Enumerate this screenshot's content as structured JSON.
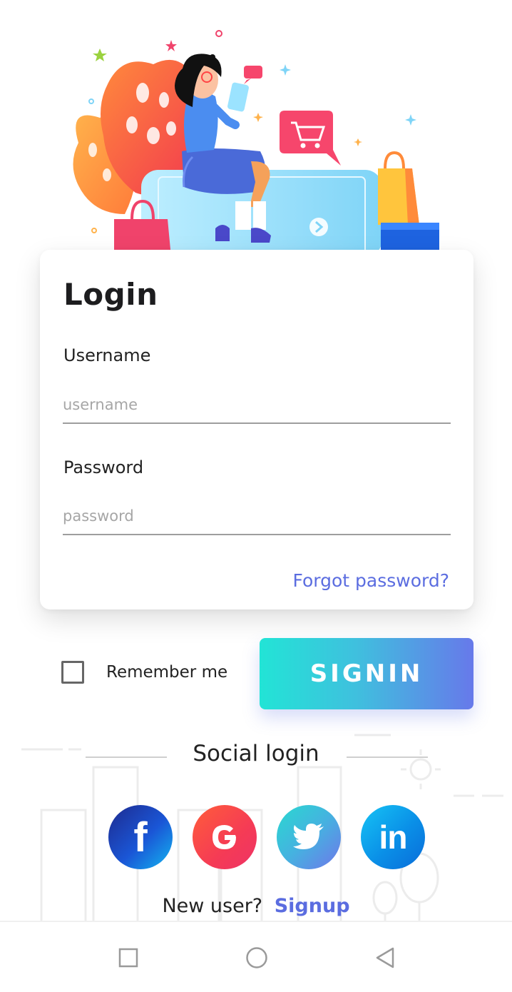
{
  "login": {
    "title": "Login",
    "username_label": "Username",
    "username_placeholder": "username",
    "username_value": "",
    "password_label": "Password",
    "password_placeholder": "password",
    "password_value": "",
    "forgot_label": "Forgot password?"
  },
  "remember": {
    "label": "Remember me",
    "checked": false
  },
  "signin_label": "SIGNIN",
  "social": {
    "title": "Social login",
    "buttons": [
      {
        "icon": "facebook-icon",
        "glyph": "f"
      },
      {
        "icon": "google-icon",
        "glyph": "G"
      },
      {
        "icon": "twitter-icon",
        "glyph": "bird"
      },
      {
        "icon": "linkedin-icon",
        "glyph": "in"
      }
    ]
  },
  "footer": {
    "prompt": "New user?",
    "signup_label": "Signup"
  },
  "navbar": {
    "items": [
      "recents-icon",
      "home-icon",
      "back-icon"
    ]
  },
  "colors": {
    "accent": "#5b6de0",
    "signin_gradient_start": "#22e4d6",
    "signin_gradient_end": "#6779ea"
  }
}
